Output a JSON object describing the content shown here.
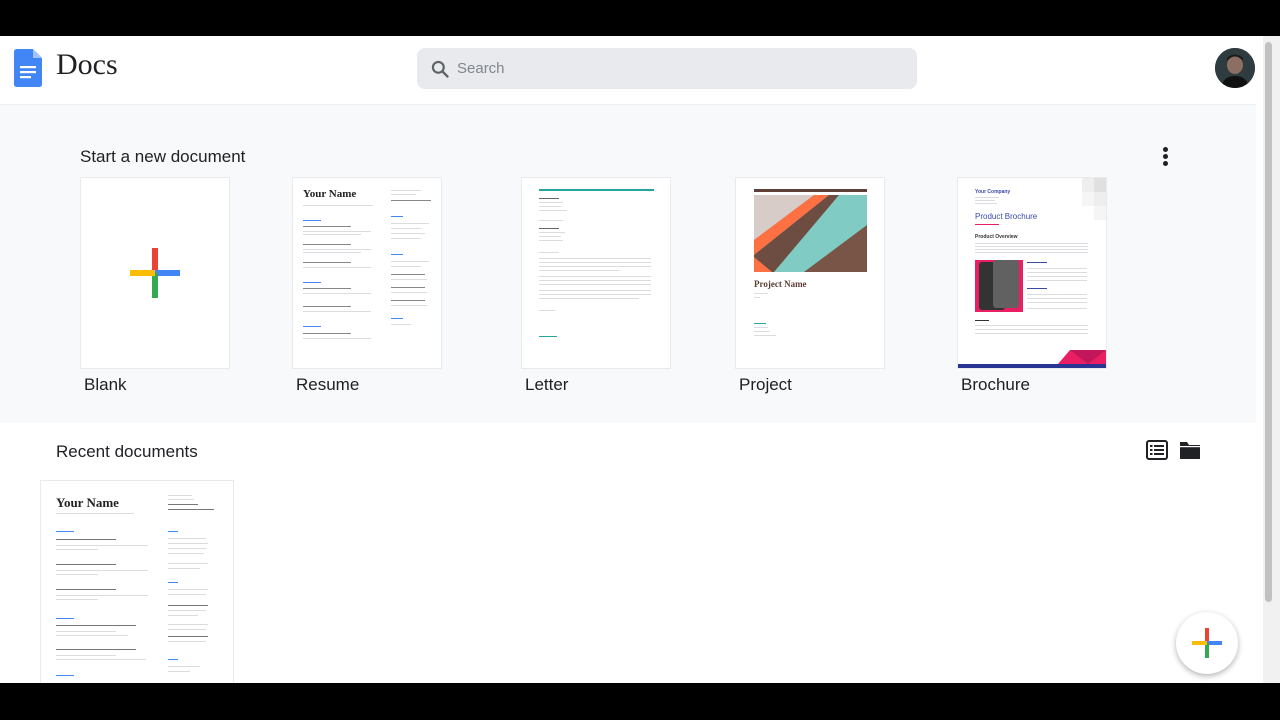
{
  "app": {
    "title": "Docs"
  },
  "search": {
    "placeholder": "Search"
  },
  "templates": {
    "title": "Start a new document",
    "items": [
      {
        "label": "Blank"
      },
      {
        "label": "Resume"
      },
      {
        "label": "Letter"
      },
      {
        "label": "Project"
      },
      {
        "label": "Brochure"
      }
    ],
    "resume_name": "Your Name",
    "project_name": "Project Name",
    "brochure_company": "Your Company",
    "brochure_title": "Product Brochure",
    "brochure_overview": "Product Overview"
  },
  "recent": {
    "title": "Recent documents",
    "docs": [
      {
        "thumb_title": "Your Name"
      }
    ]
  },
  "colors": {
    "accent": "#4285f4",
    "plus_red": "#ea4335",
    "plus_blue": "#4285f4",
    "plus_yellow": "#fbbc04",
    "plus_green": "#34a853"
  },
  "icons": [
    "docs-logo-icon",
    "search-icon",
    "more-vert-icon",
    "list-view-icon",
    "folder-icon",
    "add-icon"
  ]
}
